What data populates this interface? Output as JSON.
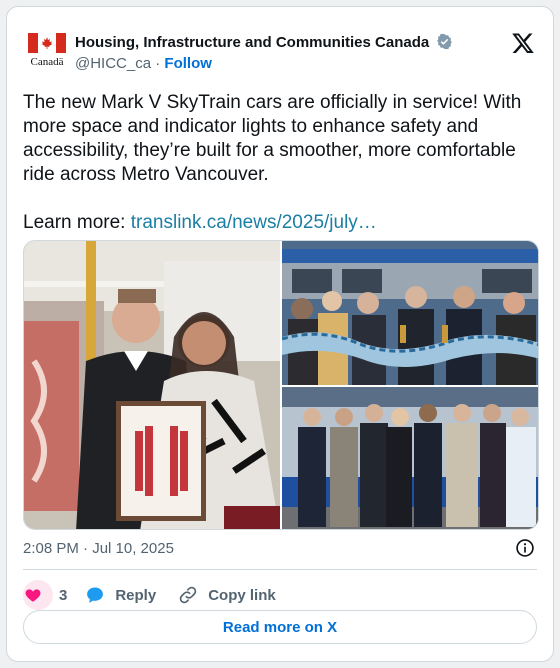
{
  "account": {
    "name": "Housing, Infrastructure and Communities Canada",
    "handle": "@HICC_ca",
    "separator": "·",
    "follow_label": "Follow",
    "logo_wordmark": "Canadä"
  },
  "tweet": {
    "text": "The new Mark V SkyTrain cars are officially in service! With more space and indicator lights to enhance safety and accessibility, they’re built for a smoother, more comfortable ride across Metro Vancouver.",
    "learn_more_label": "Learn more: ",
    "link_text": "translink.ca/news/2025/july…",
    "timestamp": "2:08 PM · Jul 10, 2025"
  },
  "media": {
    "photos": [
      {
        "name": "mayor-and-artist-with-framed-art"
      },
      {
        "name": "ribbon-cutting-ceremony"
      },
      {
        "name": "group-in-front-of-skytrain"
      }
    ]
  },
  "actions": {
    "like_count": "3",
    "reply_label": "Reply",
    "copy_link_label": "Copy link",
    "read_more_label": "Read more on X"
  },
  "colors": {
    "accent": "#006fd6",
    "link": "#1b7ea3",
    "like": "#f91880",
    "flag_red": "#d52b1e"
  }
}
